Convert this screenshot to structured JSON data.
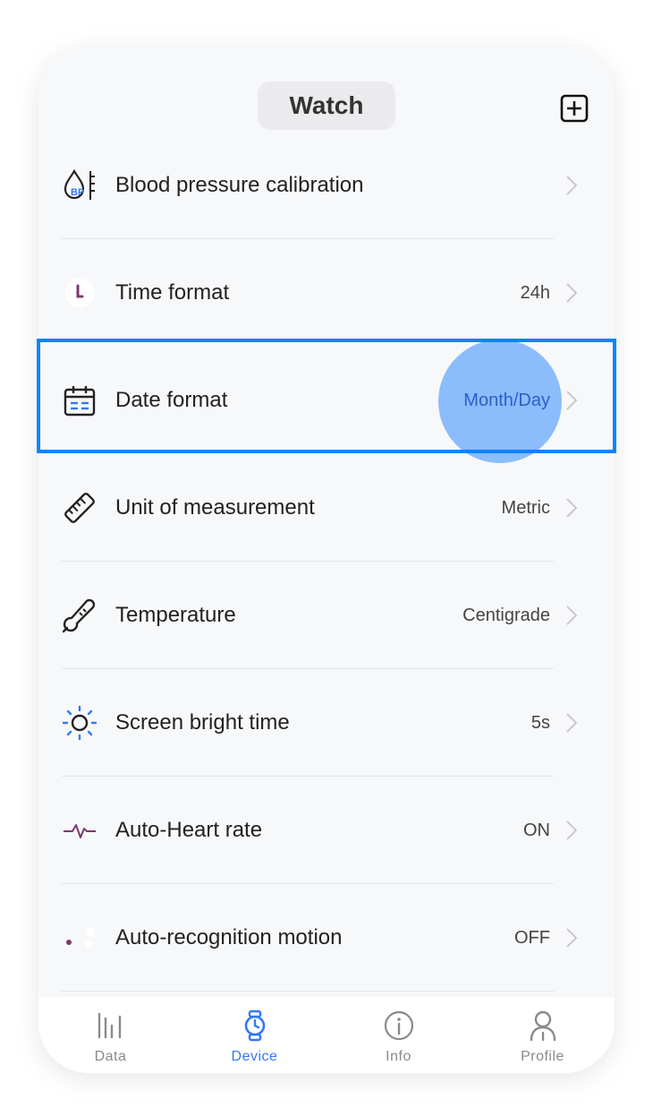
{
  "header": {
    "title": "Watch",
    "add_icon": "plus-square-icon"
  },
  "settings": [
    {
      "label": "Blood pressure calibration",
      "value": "",
      "icon": "blood-pressure-icon"
    },
    {
      "label": "Time format",
      "value": "24h",
      "icon": "clock-icon"
    },
    {
      "label": "Date format",
      "value": "Month/Day",
      "icon": "calendar-icon"
    },
    {
      "label": "Unit of measurement",
      "value": "Metric",
      "icon": "ruler-icon"
    },
    {
      "label": "Temperature",
      "value": "Centigrade",
      "icon": "thermometer-icon"
    },
    {
      "label": "Screen bright time",
      "value": "5s",
      "icon": "sun-icon"
    },
    {
      "label": "Auto-Heart rate",
      "value": "ON",
      "icon": "heartbeat-icon"
    },
    {
      "label": "Auto-recognition motion",
      "value": "OFF",
      "icon": "motion-icon"
    }
  ],
  "tabbar": {
    "tabs": [
      {
        "label": "Data",
        "icon": "bars-icon",
        "active": false
      },
      {
        "label": "Device",
        "icon": "watch-icon",
        "active": true
      },
      {
        "label": "Info",
        "icon": "info-icon",
        "active": false
      },
      {
        "label": "Profile",
        "icon": "person-icon",
        "active": false
      }
    ]
  },
  "colors": {
    "accent": "#3478f6",
    "highlight_border": "#0a84ff",
    "tap_circle": "#8bbcfc",
    "background": "#f7f8fa"
  }
}
